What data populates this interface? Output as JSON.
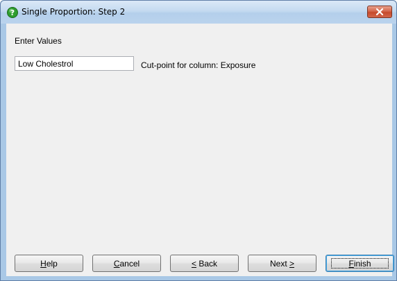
{
  "window": {
    "title": "Single Proportion: Step 2",
    "icon": "help-question-icon",
    "close_icon": "close-icon",
    "close_color": "#c64a2c"
  },
  "form": {
    "enter_values_label": "Enter Values",
    "value_input": "Low Cholestrol",
    "cutpoint_label": "Cut-point for column: Exposure"
  },
  "buttons": {
    "help": {
      "mnemonic": "H",
      "rest": "elp"
    },
    "cancel": {
      "mnemonic": "C",
      "rest": "ancel"
    },
    "back": {
      "mnemonic": "<",
      "rest": " Back"
    },
    "next": {
      "pre": "Next ",
      "mnemonic": ">"
    },
    "finish": {
      "mnemonic": "F",
      "rest": "inish"
    }
  }
}
